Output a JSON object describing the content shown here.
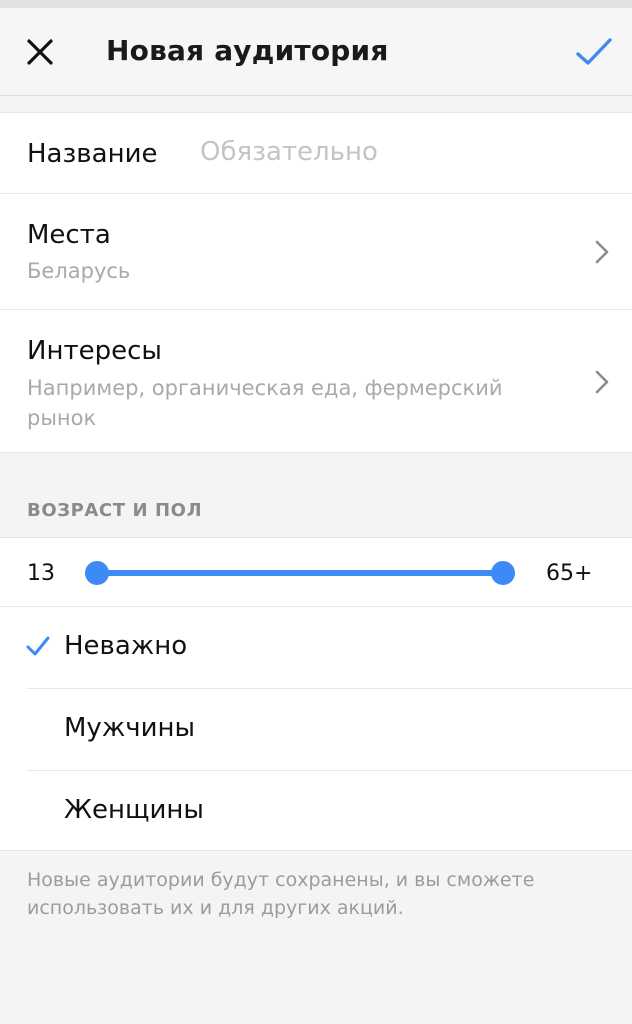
{
  "header": {
    "title": "Новая аудитория"
  },
  "form": {
    "name_label": "Название",
    "name_placeholder": "Обязательно",
    "places_label": "Места",
    "places_value": "Беларусь",
    "interests_label": "Интересы",
    "interests_hint": "Например, органическая еда, фермерский рынок"
  },
  "age_gender": {
    "section_title": "ВОЗРАСТ И ПОЛ",
    "age_min": "13",
    "age_max": "65+",
    "options": [
      {
        "label": "Неважно",
        "selected": true
      },
      {
        "label": "Мужчины",
        "selected": false
      },
      {
        "label": "Женщины",
        "selected": false
      }
    ]
  },
  "footer": {
    "note": "Новые аудитории будут сохранены, и вы сможете использовать их и для других акций."
  },
  "colors": {
    "accent": "#3d8af7",
    "text": "#111111",
    "muted": "#a9a9a9",
    "background": "#f4f4f4"
  },
  "icons": {
    "close": "close-icon",
    "done": "checkmark-icon",
    "chevron": "chevron-right-icon",
    "selected": "checkmark-icon"
  }
}
